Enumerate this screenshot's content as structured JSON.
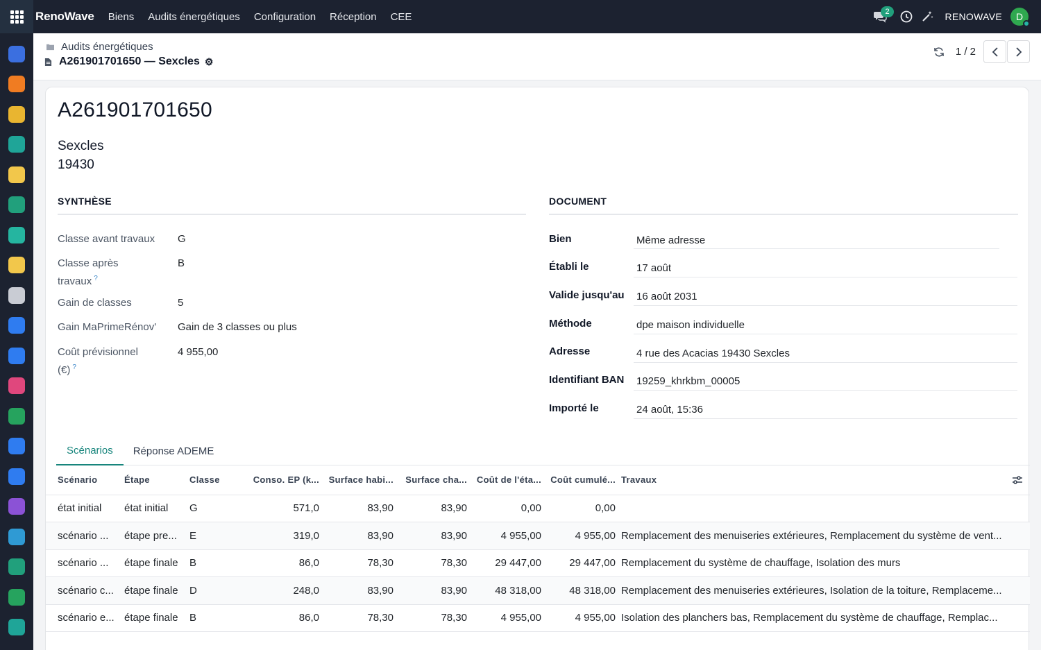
{
  "navbar": {
    "brand": "RenoWave",
    "menu": [
      "Biens",
      "Audits énergétiques",
      "Configuration",
      "Réception",
      "CEE"
    ],
    "chat_badge": "2",
    "company": "RENOWAVE",
    "avatar_initial": "D"
  },
  "dock": {
    "icons": [
      {
        "name": "app-icon",
        "color": "#3b6fe0"
      },
      {
        "name": "discuss-icon",
        "color": "#f07c22"
      },
      {
        "name": "calendar-31-icon",
        "color": "#e9b530"
      },
      {
        "name": "sign-icon",
        "color": "#1fa598"
      },
      {
        "name": "coin-icon",
        "color": "#f2c74b"
      },
      {
        "name": "contacts-icon",
        "color": "#21a07c"
      },
      {
        "name": "rocket-icon",
        "color": "#25b5a0"
      },
      {
        "name": "coin-icon",
        "color": "#f2c74b"
      },
      {
        "name": "bank-icon",
        "color": "#c9ccd4"
      },
      {
        "name": "app-icon",
        "color": "#2f7cf0"
      },
      {
        "name": "calendar-icon",
        "color": "#2f7cf0"
      },
      {
        "name": "dashboard-icon",
        "color": "#e0477d"
      },
      {
        "name": "app-icon",
        "color": "#26a35e"
      },
      {
        "name": "calendar-icon",
        "color": "#2f7cf0"
      },
      {
        "name": "app-icon",
        "color": "#2f7cf0"
      },
      {
        "name": "app-icon",
        "color": "#8b52d6"
      },
      {
        "name": "app-icon",
        "color": "#2f9ad4"
      },
      {
        "name": "people-icon",
        "color": "#21a07c"
      },
      {
        "name": "spreadsheet-icon",
        "color": "#26a35e"
      },
      {
        "name": "check-icon",
        "color": "#1fa598"
      }
    ]
  },
  "breadcrumb": {
    "parent": "Audits énergétiques",
    "current": "A261901701650 — Sexcles"
  },
  "pager": {
    "value": "1 / 2"
  },
  "record": {
    "title": "A261901701650",
    "city": "Sexcles",
    "postcode": "19430"
  },
  "synthese": {
    "heading": "SYNTHÈSE",
    "fields": [
      {
        "label": "Classe avant travaux",
        "value": "G"
      },
      {
        "label_line1": "Classe après",
        "label_line2": "travaux",
        "help": "?",
        "value": "B"
      },
      {
        "label": "Gain de classes",
        "value": "5"
      },
      {
        "label": "Gain MaPrimeRénov'",
        "value": "Gain de 3 classes ou plus"
      },
      {
        "label_line1": "Coût prévisionnel",
        "label_line2": "(€)",
        "help": "?",
        "value": "4 955,00"
      }
    ]
  },
  "document": {
    "heading": "DOCUMENT",
    "fields": [
      {
        "label": "Bien",
        "value": "Même adresse"
      },
      {
        "label": "Établi le",
        "value": "17 août"
      },
      {
        "label": "Valide jusqu'au",
        "value": "16 août 2031"
      },
      {
        "label": "Méthode",
        "value": "dpe maison individuelle"
      },
      {
        "label": "Adresse",
        "value": "4 rue des Acacias 19430 Sexcles"
      },
      {
        "label": "Identifiant BAN",
        "value": "19259_khrkbm_00005"
      },
      {
        "label": "Importé le",
        "value": "24 août, 15:36"
      }
    ]
  },
  "tabs": [
    "Scénarios",
    "Réponse ADEME"
  ],
  "table": {
    "headers": [
      "Scénario",
      "Étape",
      "Classe",
      "Conso. EP (k...",
      "Surface habi...",
      "Surface cha...",
      "Coût de l'éta...",
      "Coût cumulé...",
      "Travaux"
    ],
    "rows": [
      [
        "état initial",
        "état initial",
        "G",
        "571,0",
        "83,90",
        "83,90",
        "0,00",
        "0,00",
        ""
      ],
      [
        "scénario ...",
        "étape pre...",
        "E",
        "319,0",
        "83,90",
        "83,90",
        "4 955,00",
        "4 955,00",
        "Remplacement des menuiseries extérieures, Remplacement du système de vent..."
      ],
      [
        "scénario ...",
        "étape finale",
        "B",
        "86,0",
        "78,30",
        "78,30",
        "29 447,00",
        "29 447,00",
        "Remplacement du système de chauffage, Isolation des murs"
      ],
      [
        "scénario c...",
        "étape finale",
        "D",
        "248,0",
        "83,90",
        "83,90",
        "48 318,00",
        "48 318,00",
        "Remplacement des menuiseries extérieures, Isolation de la toiture, Remplaceme..."
      ],
      [
        "scénario e...",
        "étape finale",
        "B",
        "86,0",
        "78,30",
        "78,30",
        "4 955,00",
        "4 955,00",
        "Isolation des planchers bas, Remplacement du système de chauffage, Remplac..."
      ]
    ]
  }
}
